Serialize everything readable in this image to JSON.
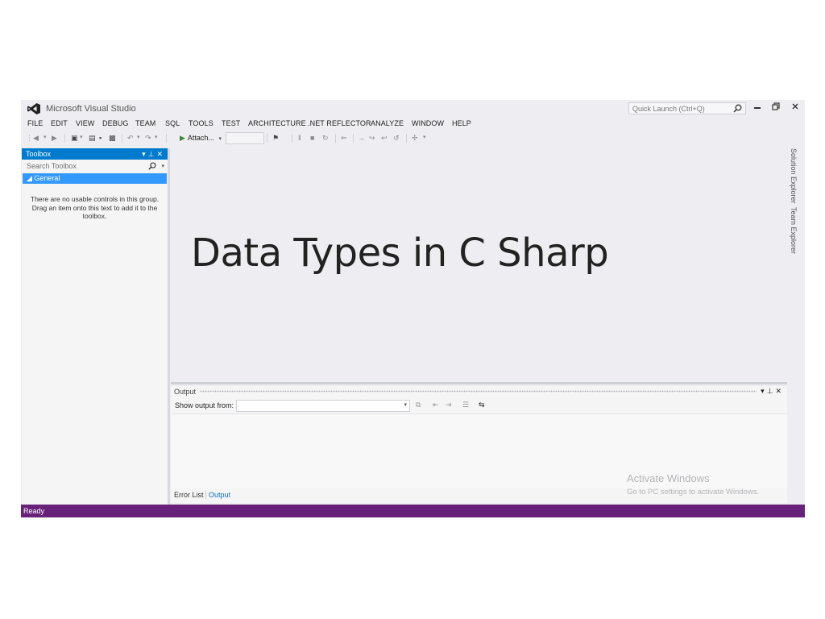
{
  "window": {
    "title": "Microsoft Visual Studio",
    "quick_launch_placeholder": "Quick Launch (Ctrl+Q)"
  },
  "menu": [
    "FILE",
    "EDIT",
    "VIEW",
    "DEBUG",
    "TEAM",
    "SQL",
    "TOOLS",
    "TEST",
    "ARCHITECTURE",
    ".NET REFLECTOR",
    "ANALYZE",
    "WINDOW",
    "HELP"
  ],
  "toolbar": {
    "attach_label": "Attach..."
  },
  "toolbox": {
    "title": "Toolbox",
    "search_placeholder": "Search Toolbox",
    "group_label": "◢ General",
    "empty_message": "There are no usable controls in this group. Drag an item onto this text to add it to the toolbox."
  },
  "editor": {
    "heading": "Data Types in C Sharp"
  },
  "side_tabs": [
    "Solution Explorer",
    "Team Explorer"
  ],
  "output": {
    "title": "Output",
    "show_output_from": "Show output from:",
    "tabs": [
      "Error List",
      "Output"
    ],
    "active_tab": "Output"
  },
  "watermark": {
    "title": "Activate Windows",
    "subtitle": "Go to PC settings to activate Windows."
  },
  "status": {
    "text": "Ready"
  },
  "colors": {
    "accent_blue": "#007acc",
    "selected_group": "#3399ff",
    "status_bar": "#68217a",
    "window_bg": "#eeeef2"
  },
  "icons": [
    "vs-logo-icon",
    "search-icon",
    "minimize-icon",
    "restore-icon",
    "close-icon",
    "pin-icon",
    "dropdown-icon",
    "play-icon"
  ]
}
